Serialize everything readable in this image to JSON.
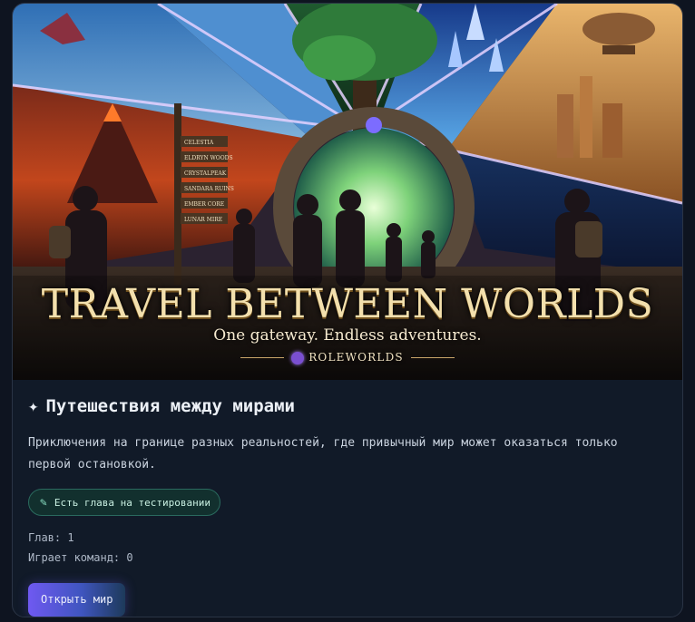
{
  "hero": {
    "title": "TRAVEL BETWEEN WORLDS",
    "tagline": "One gateway. Endless adventures.",
    "brand": "ROLEWORLDS",
    "signposts": [
      "CELESTIA",
      "ELDRYN WOODS",
      "CRYSTALPEAK",
      "SANDARA RUINS",
      "EMBER CORE",
      "LUNAR MIRE"
    ]
  },
  "card": {
    "title_icon": "✦",
    "title": "Путешествия между мирами",
    "description": "Приключения на границе разных реальностей, где привычный мир может оказаться только первой остановкой.",
    "badge_icon": "pencil-icon",
    "badge_label": "Есть глава на тестировании",
    "chapters": "Глав: 1",
    "teams_playing": "Играет команд: 0",
    "open_button": "Открыть мир"
  },
  "colors": {
    "background": "#0e1420",
    "card": "#111a28",
    "badge_bg": "#12302e",
    "badge_border": "#2a6a5e",
    "button_start": "#6f59f1",
    "button_end": "#1d3a5a"
  }
}
